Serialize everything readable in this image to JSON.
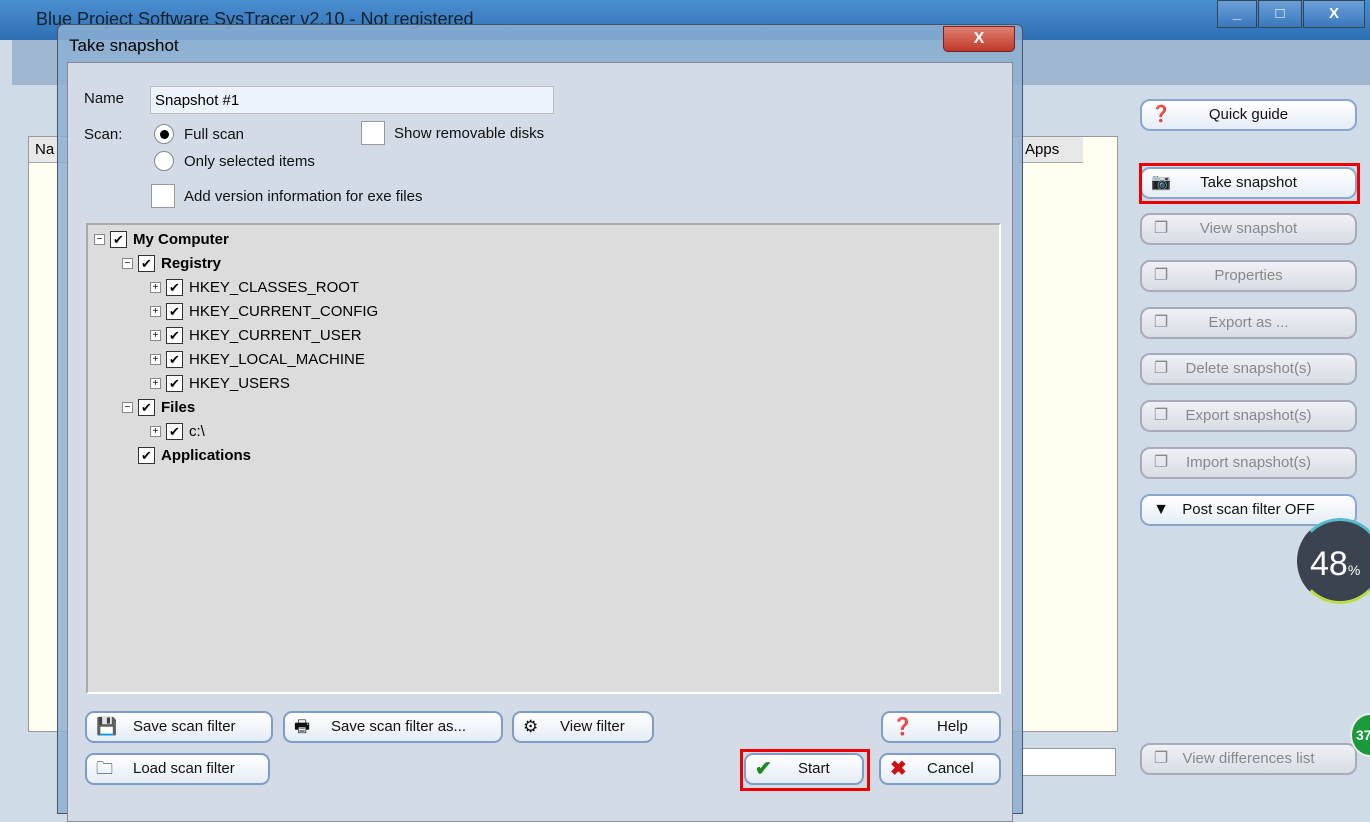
{
  "app": {
    "title": "Blue Project Software SysTracer v2.10 - Not registered",
    "column_apps": "Apps",
    "column_name": "Na"
  },
  "right_buttons": [
    {
      "label": "Quick guide",
      "icon": "help-icon",
      "enabled": true
    },
    {
      "label": "Take snapshot",
      "icon": "camera-icon",
      "enabled": true
    },
    {
      "label": "View snapshot",
      "icon": "camera-view-icon",
      "enabled": false
    },
    {
      "label": "Properties",
      "icon": "properties-icon",
      "enabled": false
    },
    {
      "label": "Export as ...",
      "icon": "export-icon",
      "enabled": false
    },
    {
      "label": "Delete snapshot(s)",
      "icon": "delete-icon",
      "enabled": false
    },
    {
      "label": "Export snapshot(s)",
      "icon": "export-icon",
      "enabled": false
    },
    {
      "label": "Import snapshot(s)",
      "icon": "import-icon",
      "enabled": false
    },
    {
      "label": "Post scan filter OFF",
      "icon": "filter-icon",
      "enabled": true
    },
    {
      "label": "View differences list",
      "icon": "list-icon",
      "enabled": false
    }
  ],
  "overlay": {
    "gauge_value": "48",
    "gauge_unit": "%",
    "badge": "37"
  },
  "dialog": {
    "title": "Take snapshot",
    "close": "X",
    "name_label": "Name",
    "name_value": "Snapshot #1",
    "scan_label": "Scan:",
    "full_scan": "Full scan",
    "only_selected": "Only selected items",
    "scan_selected": "full",
    "show_removable": "Show removable disks",
    "show_removable_checked": false,
    "add_version": "Add version information for exe files",
    "add_version_checked": false,
    "tree": [
      {
        "label": "My Computer",
        "bold": true,
        "level": 0,
        "expander": "minus",
        "checked": true
      },
      {
        "label": "Registry",
        "bold": true,
        "level": 1,
        "expander": "minus",
        "checked": true
      },
      {
        "label": "HKEY_CLASSES_ROOT",
        "bold": false,
        "level": 2,
        "expander": "plus",
        "checked": true
      },
      {
        "label": "HKEY_CURRENT_CONFIG",
        "bold": false,
        "level": 2,
        "expander": "plus",
        "checked": true
      },
      {
        "label": "HKEY_CURRENT_USER",
        "bold": false,
        "level": 2,
        "expander": "plus",
        "checked": true
      },
      {
        "label": "HKEY_LOCAL_MACHINE",
        "bold": false,
        "level": 2,
        "expander": "plus",
        "checked": true
      },
      {
        "label": "HKEY_USERS",
        "bold": false,
        "level": 2,
        "expander": "plus",
        "checked": true
      },
      {
        "label": "Files",
        "bold": true,
        "level": 1,
        "expander": "minus",
        "checked": true
      },
      {
        "label": "c:\\",
        "bold": false,
        "level": 2,
        "expander": "plus",
        "checked": true
      },
      {
        "label": "Applications",
        "bold": true,
        "level": 1,
        "expander": "none",
        "checked": true
      }
    ],
    "buttons": {
      "save_filter": "Save scan filter",
      "save_filter_as": "Save scan filter as...",
      "view_filter": "View filter",
      "help": "Help",
      "load_filter": "Load scan filter",
      "start": "Start",
      "cancel": "Cancel"
    }
  }
}
